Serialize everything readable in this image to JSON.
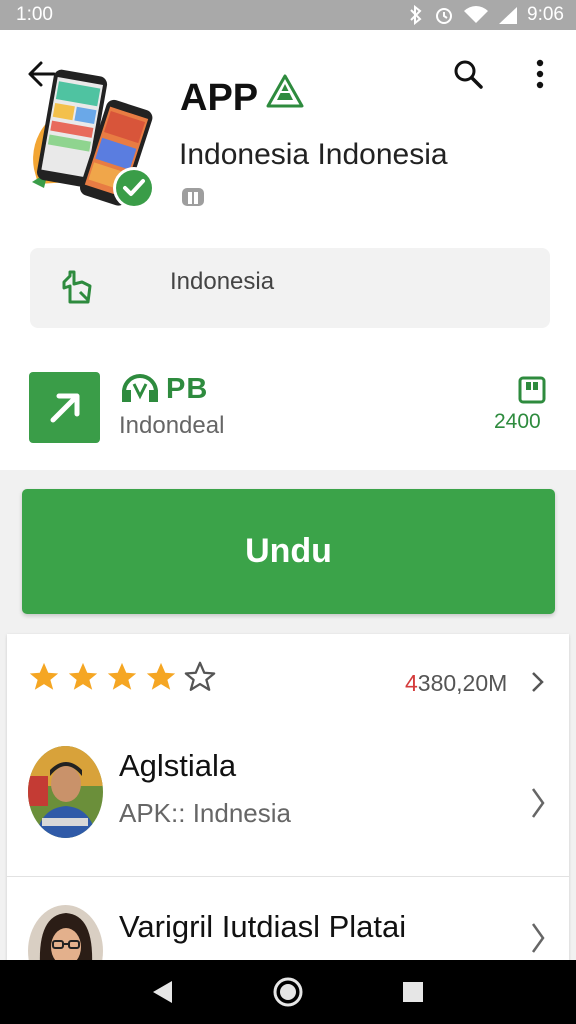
{
  "status_bar": {
    "time": "1:00",
    "battery_time": "9:06"
  },
  "app": {
    "title": "APP",
    "subtitle": "Indonesia Indonesia"
  },
  "info_card": {
    "text": "Indonesia"
  },
  "developer": {
    "badge": "PB",
    "name": "Indondeal",
    "size": "2400"
  },
  "install": {
    "label": "Undu"
  },
  "rating": {
    "stars_filled": 4,
    "stars_total": 5,
    "count_red": "4",
    "count_rest": "380,20M"
  },
  "reviews": [
    {
      "name": "Aglstiala",
      "text": "APK:: Indnesia"
    },
    {
      "name": "Varigril Iutdiasl Platai",
      "text": ""
    }
  ],
  "colors": {
    "accent": "#3ba349",
    "star": "#f5a623",
    "status_bar": "#a9a9a9"
  }
}
